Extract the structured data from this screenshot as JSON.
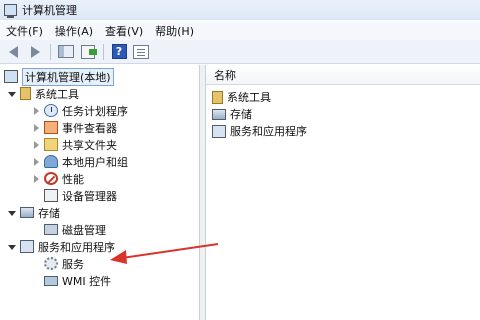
{
  "window": {
    "title": "计算机管理"
  },
  "menubar": [
    "文件(F)",
    "操作(A)",
    "查看(V)",
    "帮助(H)"
  ],
  "toolbar": {
    "help_glyph": "?"
  },
  "tree": {
    "root": "计算机管理(本地)",
    "system_tools": "系统工具",
    "task_scheduler": "任务计划程序",
    "event_viewer": "事件查看器",
    "shared_folders": "共享文件夹",
    "local_users": "本地用户和组",
    "performance": "性能",
    "device_manager": "设备管理器",
    "storage": "存储",
    "disk_management": "磁盘管理",
    "services_apps": "服务和应用程序",
    "services": "服务",
    "wmi": "WMI 控件"
  },
  "list": {
    "header": "名称",
    "items": [
      "系统工具",
      "存储",
      "服务和应用程序"
    ]
  },
  "colors": {
    "annotation_arrow": "#d9342b",
    "selection": "#e6f0fb"
  }
}
